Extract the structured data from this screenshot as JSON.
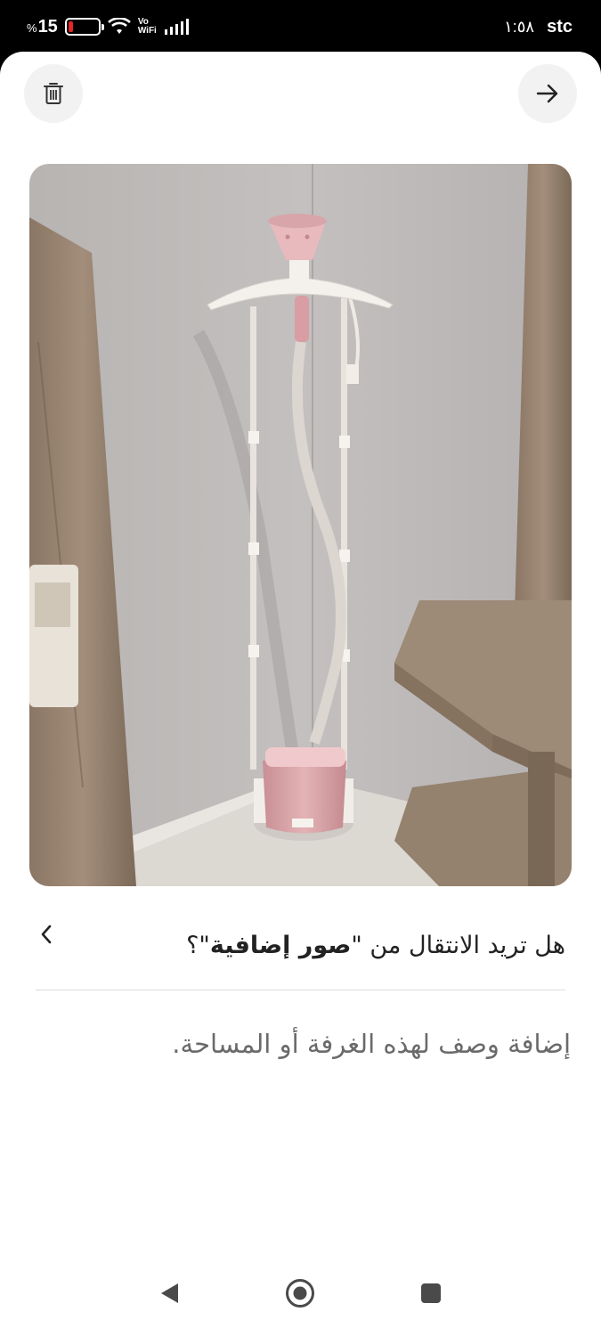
{
  "status_bar": {
    "battery_percent": "15",
    "percent_sign": "%",
    "vowifi_top": "Vo",
    "vowifi_bottom": "WiFi",
    "time": "١:٥٨",
    "carrier": "stc",
    "battery_color": "#e3262a"
  },
  "header": {
    "delete_icon": "trash-icon",
    "forward_icon": "arrow-right-icon"
  },
  "photo": {
    "subject": "garment steamer"
  },
  "question": {
    "prefix": "هل تريد الانتقال من \"",
    "bold": "صور إضافية",
    "suffix": "\"؟"
  },
  "description": {
    "placeholder": "إضافة وصف لهذه الغرفة أو المساحة."
  },
  "nav": {
    "back_icon": "triangle-back-icon",
    "home_icon": "circle-home-icon",
    "recents_icon": "square-recents-icon"
  }
}
